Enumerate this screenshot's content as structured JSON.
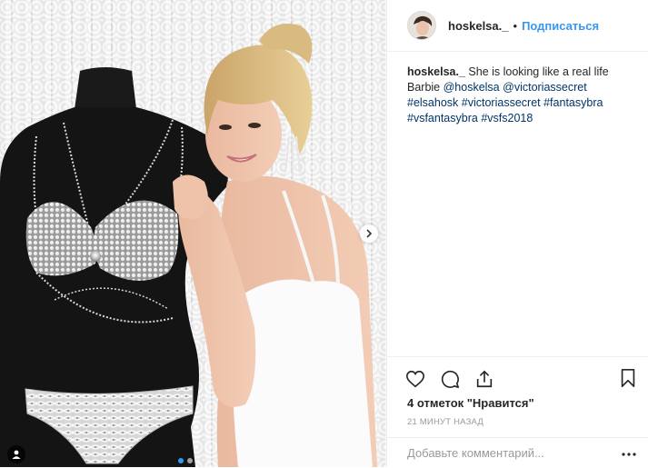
{
  "post": {
    "username": "hoskelsa._",
    "dot": "•",
    "follow_label": "Подписаться",
    "caption": {
      "username": "hoskelsa._",
      "text": " She is looking like a real life Barbie ",
      "mentions": [
        "@hoskelsa",
        "@victoriassecret"
      ],
      "hashtags": [
        "#elsahosk",
        "#victoriassecret",
        "#fantasybra",
        "#vsfantasybra",
        "#vsfs2018"
      ]
    },
    "likes_text": "4 отметок \"Нравится\"",
    "time_text": "21 минут назад",
    "comment_placeholder": "Добавьте комментарий...",
    "icons": {
      "like": "heart-icon",
      "comment": "comment-icon",
      "share": "share-icon",
      "save": "bookmark-icon",
      "more": "more-options-icon",
      "user_tag": "user-tag-icon",
      "next": "chevron-right-icon"
    },
    "colors": {
      "accent": "#3897f0",
      "text": "#262626",
      "muted": "#999999",
      "link": "#003569",
      "border": "#efefef"
    }
  }
}
